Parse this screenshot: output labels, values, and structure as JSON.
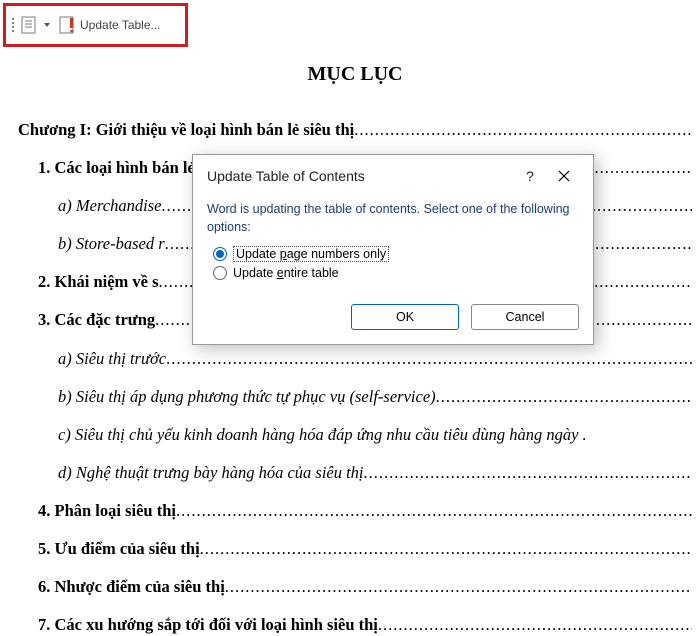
{
  "toolbar": {
    "update_label": "Update Table..."
  },
  "doc": {
    "title": "MỤC LỤC",
    "chapter": "Chương I: Giới thiệu về loại hình bán lẻ siêu thị",
    "h1": "1. Các loại hình bán lẻ",
    "h1a": "a) Merchandise",
    "h1b": "b) Store-based r",
    "h2": "2. Khái niệm về s",
    "h3": "3. Các đặc trưng ",
    "h3a": "a) Siêu thị trước",
    "h3b": "b) Siêu thị áp dụng phương thức tự phục vụ (self-service)",
    "h3c": "c) Siêu thị chủ yếu kinh doanh hàng hóa đáp ứng nhu cầu tiêu dùng hàng ngày .",
    "h3d": "d) Nghệ thuật trưng bày hàng hóa của siêu thị",
    "h4": "4. Phân loại siêu thị",
    "h5": "5. Ưu điểm của siêu thị",
    "h6": "6. Nhược điểm của siêu thị",
    "h7": "7. Các xu hướng sắp tới đối với loại hình siêu thị"
  },
  "dialog": {
    "title": "Update Table of Contents",
    "help": "?",
    "msg": "Word is updating the table of contents.  Select one of the following options:",
    "opt1_pre": "Update ",
    "opt1_acc": "p",
    "opt1_post": "age numbers only",
    "opt2_pre": "Update ",
    "opt2_acc": "e",
    "opt2_post": "ntire table",
    "ok": "OK",
    "cancel": "Cancel"
  }
}
